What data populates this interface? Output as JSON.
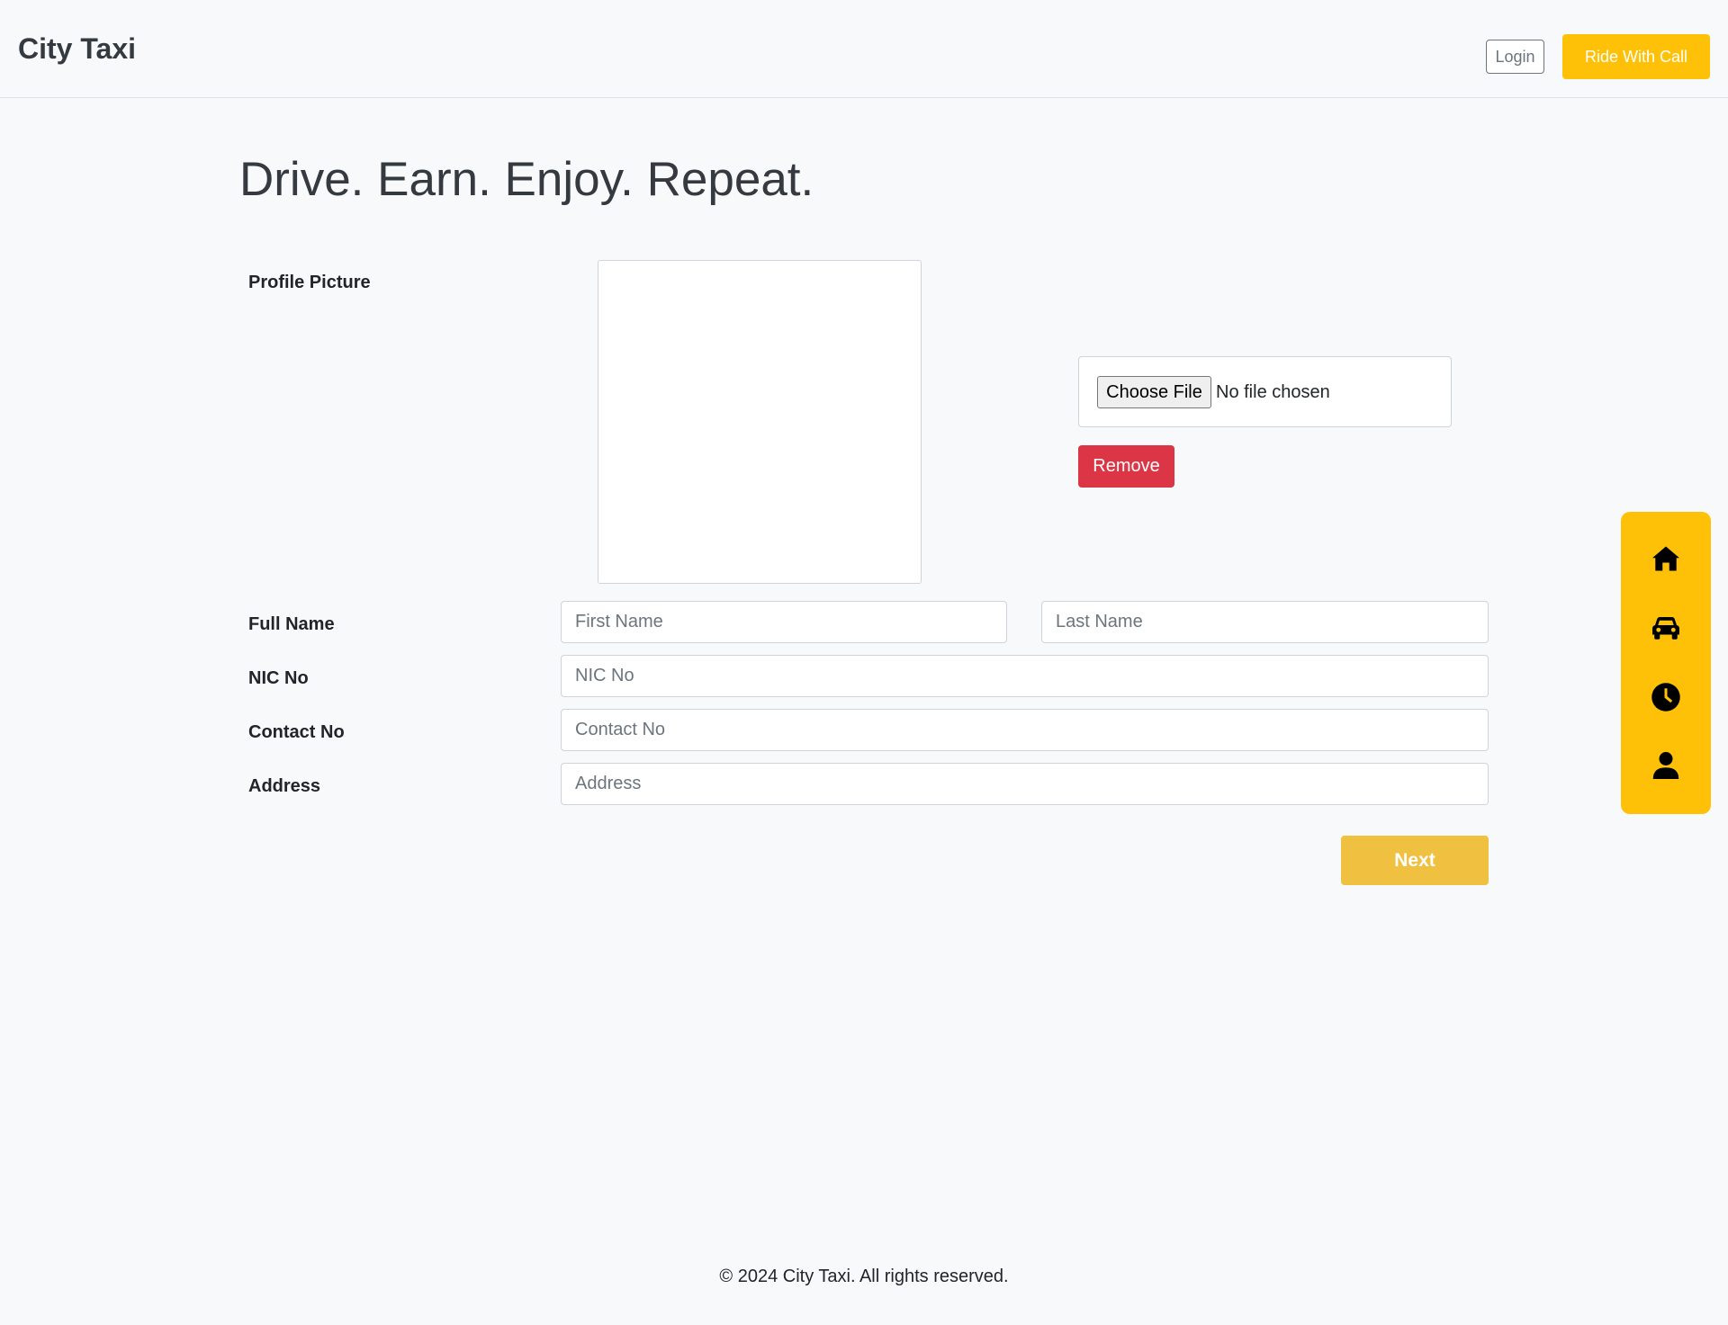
{
  "header": {
    "brand": "City Taxi",
    "login_label": "Login",
    "call_label": "Ride With Call"
  },
  "hero": {
    "title": "Drive. Earn. Enjoy. Repeat."
  },
  "form": {
    "profile_picture_label": "Profile Picture",
    "file_button_label": "Choose File",
    "file_status": "No file chosen",
    "remove_label": "Remove",
    "full_name_label": "Full Name",
    "first_name_placeholder": "First Name",
    "last_name_placeholder": "Last Name",
    "nic_label": "NIC No",
    "nic_placeholder": "NIC No",
    "contact_label": "Contact No",
    "contact_placeholder": "Contact No",
    "address_label": "Address",
    "address_placeholder": "Address",
    "next_label": "Next"
  },
  "side_nav": {
    "items": [
      {
        "icon": "home-icon"
      },
      {
        "icon": "car-icon"
      },
      {
        "icon": "clock-icon"
      },
      {
        "icon": "user-icon"
      }
    ]
  },
  "footer": {
    "text": "© 2024 City Taxi. All rights reserved."
  },
  "colors": {
    "accent": "#ffc107",
    "next_button": "#f0c040",
    "danger": "#dc3545",
    "background": "#f8f9fa"
  }
}
